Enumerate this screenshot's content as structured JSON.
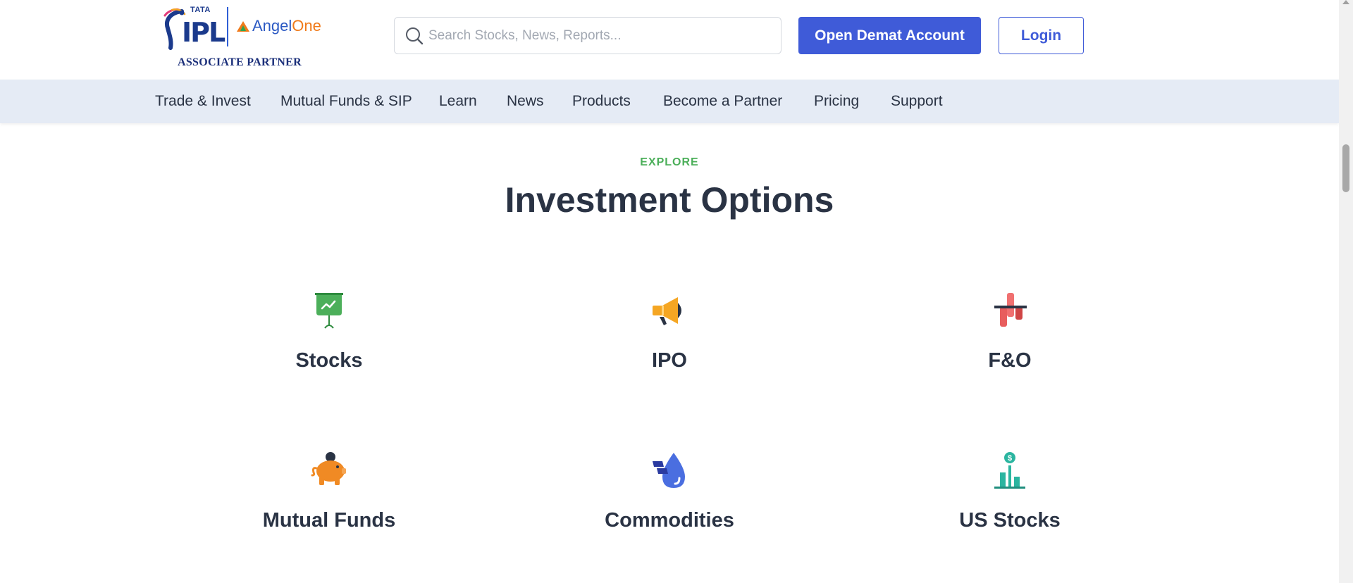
{
  "header": {
    "logo": {
      "ipl_tata": "TATA",
      "ipl_text": "IPL",
      "angel_name": "Angel",
      "angel_suffix": "One",
      "associate": "ASSOCIATE PARTNER"
    },
    "search": {
      "placeholder": "Search Stocks, News, Reports..."
    },
    "buttons": {
      "demat": "Open Demat Account",
      "login": "Login"
    }
  },
  "nav": {
    "items": [
      {
        "label": "Trade & Invest"
      },
      {
        "label": "Mutual Funds & SIP"
      },
      {
        "label": "Learn"
      },
      {
        "label": "News"
      },
      {
        "label": "Products"
      },
      {
        "label": "Become a Partner"
      },
      {
        "label": "Pricing"
      },
      {
        "label": "Support"
      }
    ]
  },
  "section": {
    "eyebrow": "EXPLORE",
    "title": "Investment Options",
    "options": [
      {
        "label": "Stocks",
        "icon": "presentation-chart-icon",
        "color": "#4caf5a"
      },
      {
        "label": "IPO",
        "icon": "megaphone-icon",
        "color": "#f5a623"
      },
      {
        "label": "F&O",
        "icon": "candlestick-icon",
        "color": "#e85d5d"
      },
      {
        "label": "Mutual Funds",
        "icon": "piggy-bank-icon",
        "color": "#f08a24"
      },
      {
        "label": "Commodities",
        "icon": "oil-drop-gold-icon",
        "color": "#4a6ee0"
      },
      {
        "label": "US Stocks",
        "icon": "dollar-bars-icon",
        "color": "#2bb5a0"
      }
    ]
  },
  "colors": {
    "brand_blue": "#3f5bd8",
    "nav_bg": "#e5ebf5",
    "accent_green": "#4caf5a",
    "heading": "#2a3344"
  }
}
